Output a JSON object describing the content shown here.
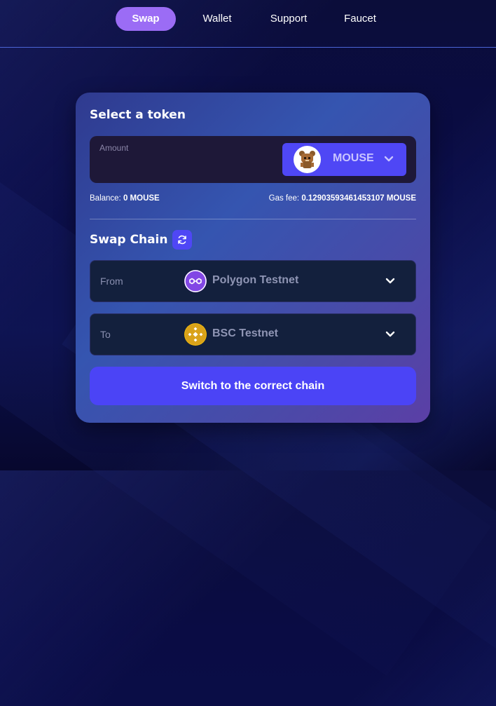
{
  "nav": {
    "items": [
      {
        "label": "Swap",
        "active": true
      },
      {
        "label": "Wallet",
        "active": false
      },
      {
        "label": "Support",
        "active": false
      },
      {
        "label": "Faucet",
        "active": false
      }
    ]
  },
  "swap": {
    "title": "Select a token",
    "amount": {
      "label": "Amount",
      "value": ""
    },
    "token": {
      "name": "MOUSE",
      "icon": "mouse-token-icon"
    },
    "balance": {
      "label": "Balance:",
      "value": "0 MOUSE"
    },
    "gas_fee": {
      "label": "Gas fee:",
      "value": "0.12903593461453107 MOUSE"
    }
  },
  "swap_chain": {
    "title": "Swap Chain",
    "from": {
      "label": "From",
      "chain": "Polygon Testnet",
      "icon": "polygon-icon"
    },
    "to": {
      "label": "To",
      "chain": "BSC Testnet",
      "icon": "bsc-icon"
    }
  },
  "switch_button": {
    "label": "Switch to the correct chain"
  },
  "colors": {
    "accent": "#4f47f5",
    "nav_active": "#9b6cf5",
    "polygon": "#8247e5",
    "bsc": "#f0b90b"
  }
}
